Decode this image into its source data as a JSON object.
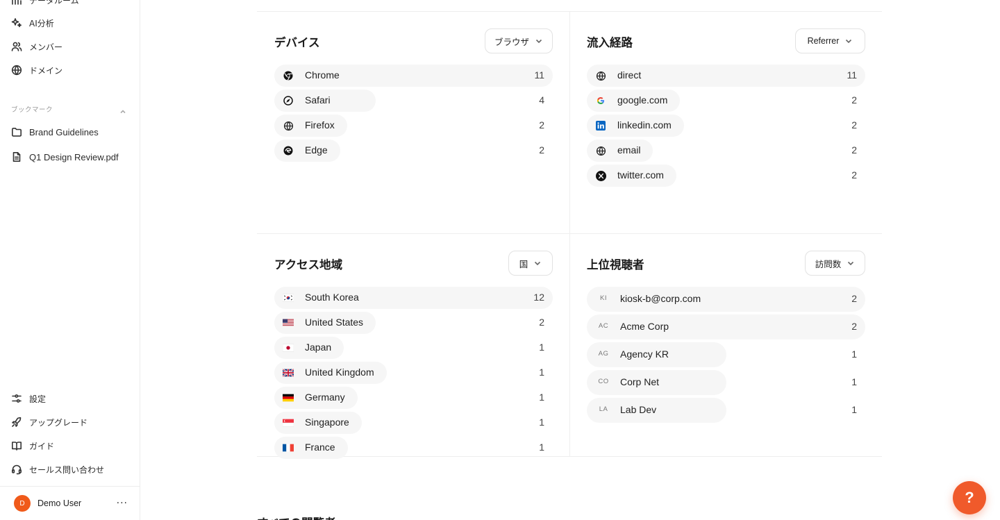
{
  "sidebar": {
    "top_item_partial": "データルーム",
    "items": [
      {
        "label": "AI分析",
        "icon": "sparkles-icon"
      },
      {
        "label": "メンバー",
        "icon": "users-icon"
      },
      {
        "label": "ドメイン",
        "icon": "globe-icon"
      }
    ],
    "bookmarks_label": "ブックマーク",
    "bookmarks": [
      {
        "label": "Brand Guidelines",
        "icon": "folder-icon"
      },
      {
        "label": "Q1 Design Review.pdf",
        "icon": "file-icon"
      }
    ],
    "bottom_items": [
      {
        "label": "設定",
        "icon": "sliders-icon"
      },
      {
        "label": "アップグレード",
        "icon": "rocket-icon"
      },
      {
        "label": "ガイド",
        "icon": "book-icon"
      },
      {
        "label": "セールス問い合わせ",
        "icon": "headset-icon"
      }
    ],
    "user": {
      "initial": "D",
      "name": "Demo User",
      "more": "···"
    }
  },
  "panels": {
    "devices": {
      "title": "デバイス",
      "dropdown": "ブラウザ",
      "rows": [
        {
          "label": "Chrome",
          "count": "11",
          "icon": "chrome-icon",
          "fraction": 1.0
        },
        {
          "label": "Safari",
          "count": "4",
          "icon": "safari-icon",
          "fraction": 0.364
        },
        {
          "label": "Firefox",
          "count": "2",
          "icon": "globe-icon",
          "fraction": 0.182
        },
        {
          "label": "Edge",
          "count": "2",
          "icon": "edge-icon",
          "fraction": 0.182
        }
      ]
    },
    "referrers": {
      "title": "流入経路",
      "dropdown": "Referrer",
      "rows": [
        {
          "label": "direct",
          "count": "11",
          "icon": "globe-icon",
          "fraction": 1.0
        },
        {
          "label": "google.com",
          "count": "2",
          "icon": "google-icon",
          "fraction": 0.182
        },
        {
          "label": "linkedin.com",
          "count": "2",
          "icon": "linkedin-icon",
          "fraction": 0.182
        },
        {
          "label": "email",
          "count": "2",
          "icon": "globe-icon",
          "fraction": 0.182
        },
        {
          "label": "twitter.com",
          "count": "2",
          "icon": "x-icon",
          "fraction": 0.182
        }
      ]
    },
    "regions": {
      "title": "アクセス地域",
      "dropdown": "国",
      "rows": [
        {
          "label": "South Korea",
          "count": "12",
          "icon": "flag-kr-icon",
          "fraction": 1.0
        },
        {
          "label": "United States",
          "count": "2",
          "icon": "flag-us-icon",
          "fraction": 0.167
        },
        {
          "label": "Japan",
          "count": "1",
          "icon": "flag-jp-icon",
          "fraction": 0.083
        },
        {
          "label": "United Kingdom",
          "count": "1",
          "icon": "flag-gb-icon",
          "fraction": 0.083
        },
        {
          "label": "Germany",
          "count": "1",
          "icon": "flag-de-icon",
          "fraction": 0.083
        },
        {
          "label": "Singapore",
          "count": "1",
          "icon": "flag-sg-icon",
          "fraction": 0.083
        },
        {
          "label": "France",
          "count": "1",
          "icon": "flag-fr-icon",
          "fraction": 0.083
        }
      ]
    },
    "viewers": {
      "title": "上位視聴者",
      "dropdown": "訪問数",
      "rows": [
        {
          "initials": "KI",
          "label": "kiosk-b@corp.com",
          "count": "2",
          "fraction": 1.0
        },
        {
          "initials": "AC",
          "label": "Acme Corp",
          "count": "2",
          "fraction": 1.0
        },
        {
          "initials": "AG",
          "label": "Agency KR",
          "count": "1",
          "fraction": 0.5
        },
        {
          "initials": "CO",
          "label": "Corp Net",
          "count": "1",
          "fraction": 0.5
        },
        {
          "initials": "LA",
          "label": "Lab Dev",
          "count": "1",
          "fraction": 0.5
        }
      ]
    }
  },
  "bottom_section_title": "すべての閲覧者",
  "help_button": "?"
}
